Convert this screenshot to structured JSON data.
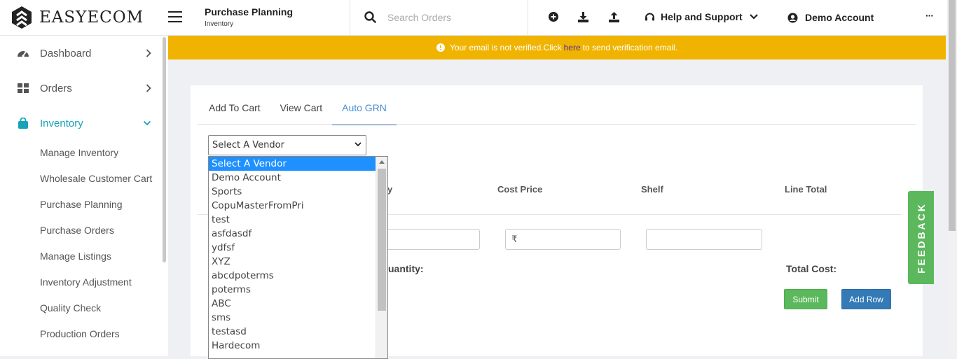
{
  "brand": {
    "name": "EASYECOM"
  },
  "header": {
    "page_title": "Purchase Planning",
    "page_subtitle": "Inventory",
    "search_placeholder": "Search Orders",
    "help_label": "Help and Support",
    "account_label": "Demo Account",
    "more_label": "···"
  },
  "sidebar": {
    "items": [
      {
        "label": "Dashboard",
        "icon": "gauge-icon"
      },
      {
        "label": "Orders",
        "icon": "grid-icon"
      },
      {
        "label": "Inventory",
        "icon": "shopping-bag-icon"
      }
    ],
    "subitems": [
      "Manage Inventory",
      "Wholesale Customer Cart",
      "Purchase Planning",
      "Purchase Orders",
      "Manage Listings",
      "Inventory Adjustment",
      "Quality Check",
      "Production Orders"
    ]
  },
  "alert": {
    "text_before": "Your email is not verified.Click",
    "link": "here",
    "text_after": "to send verification email."
  },
  "tabs": [
    "Add To Cart",
    "View Cart",
    "Auto GRN"
  ],
  "form": {
    "vendor_selected": "Select A Vendor",
    "columns": {
      "qty_partial": "y",
      "cost_price": "Cost Price",
      "shelf": "Shelf",
      "line_total": "Line Total"
    },
    "currency_symbol": "₹",
    "total_quantity_partial": "uantity:",
    "total_cost": "Total Cost:",
    "submit_label": "Submit",
    "add_row_label": "Add Row"
  },
  "vendor_options": [
    "Select A Vendor",
    "Demo Account",
    "Sports",
    "CopuMasterFromPri",
    "test",
    "asfdasdf",
    "ydfsf",
    "XYZ",
    "abcdpoterms",
    "poterms",
    "ABC",
    "sms",
    "testasd",
    "Hardecom"
  ],
  "feedback_label": "FEEDBACK",
  "colors": {
    "accent": "#17a2b8",
    "alert": "#f0b400",
    "tab_active": "#4a8fd1",
    "submit": "#5cb85c",
    "add_row": "#337ab7",
    "selection": "#1e90ff"
  }
}
